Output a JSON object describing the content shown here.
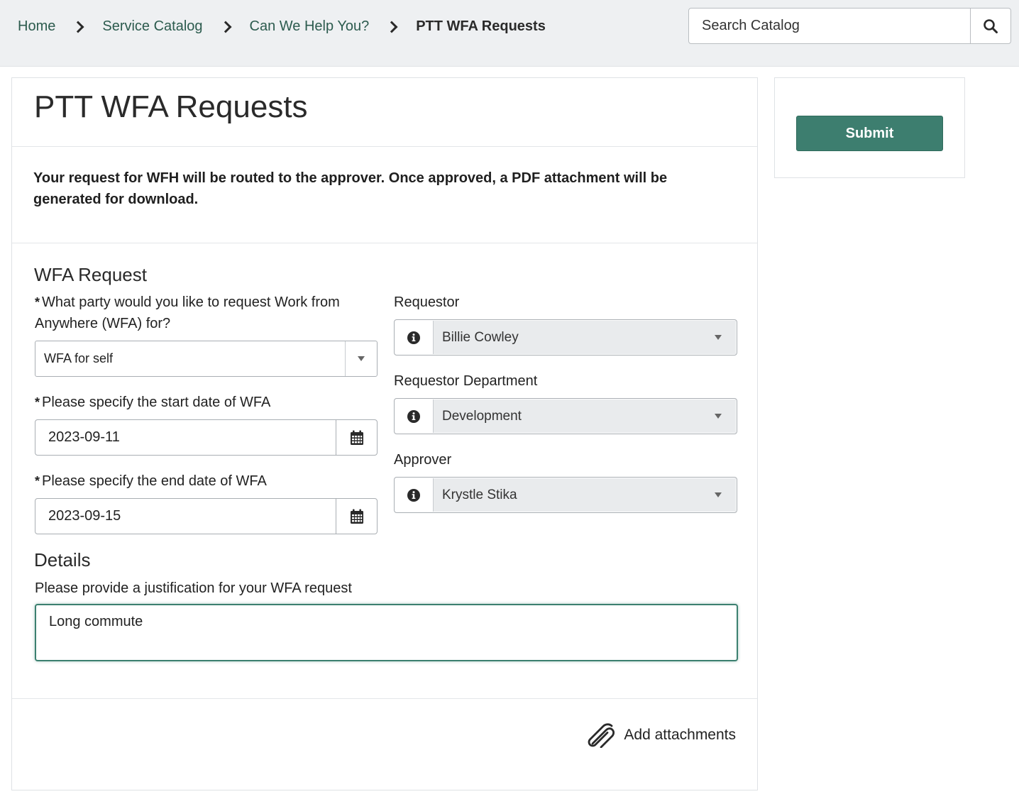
{
  "breadcrumb": {
    "items": [
      "Home",
      "Service Catalog",
      "Can We Help You?"
    ],
    "current": "PTT WFA Requests"
  },
  "search": {
    "placeholder": "Search Catalog",
    "icon": "search-icon"
  },
  "form": {
    "title": "PTT WFA Requests",
    "notice": "Your request for WFH will be routed to the approver.  Once approved, a PDF attachment will be generated for download.",
    "section_request": "WFA Request",
    "party_label": "What party would you like to request Work from Anywhere (WFA) for?",
    "party_value": "WFA for self",
    "start_label": "Please specify the start date of WFA",
    "start_value": "2023-09-11",
    "end_label": "Please specify the end date of WFA",
    "end_value": "2023-09-15",
    "requestor_label": "Requestor",
    "requestor_value": "Billie Cowley",
    "department_label": "Requestor Department",
    "department_value": "Development",
    "approver_label": "Approver",
    "approver_value": "Krystle Stika",
    "section_details": "Details",
    "justification_label": "Please provide a justification for your WFA request",
    "justification_value": "Long commute",
    "required_mark": "*",
    "attach_label": "Add attachments"
  },
  "sidebar": {
    "submit_label": "Submit"
  },
  "colors": {
    "accent": "#3d7e6f",
    "link": "#2c5b4e",
    "topbar": "#eef0f2"
  }
}
